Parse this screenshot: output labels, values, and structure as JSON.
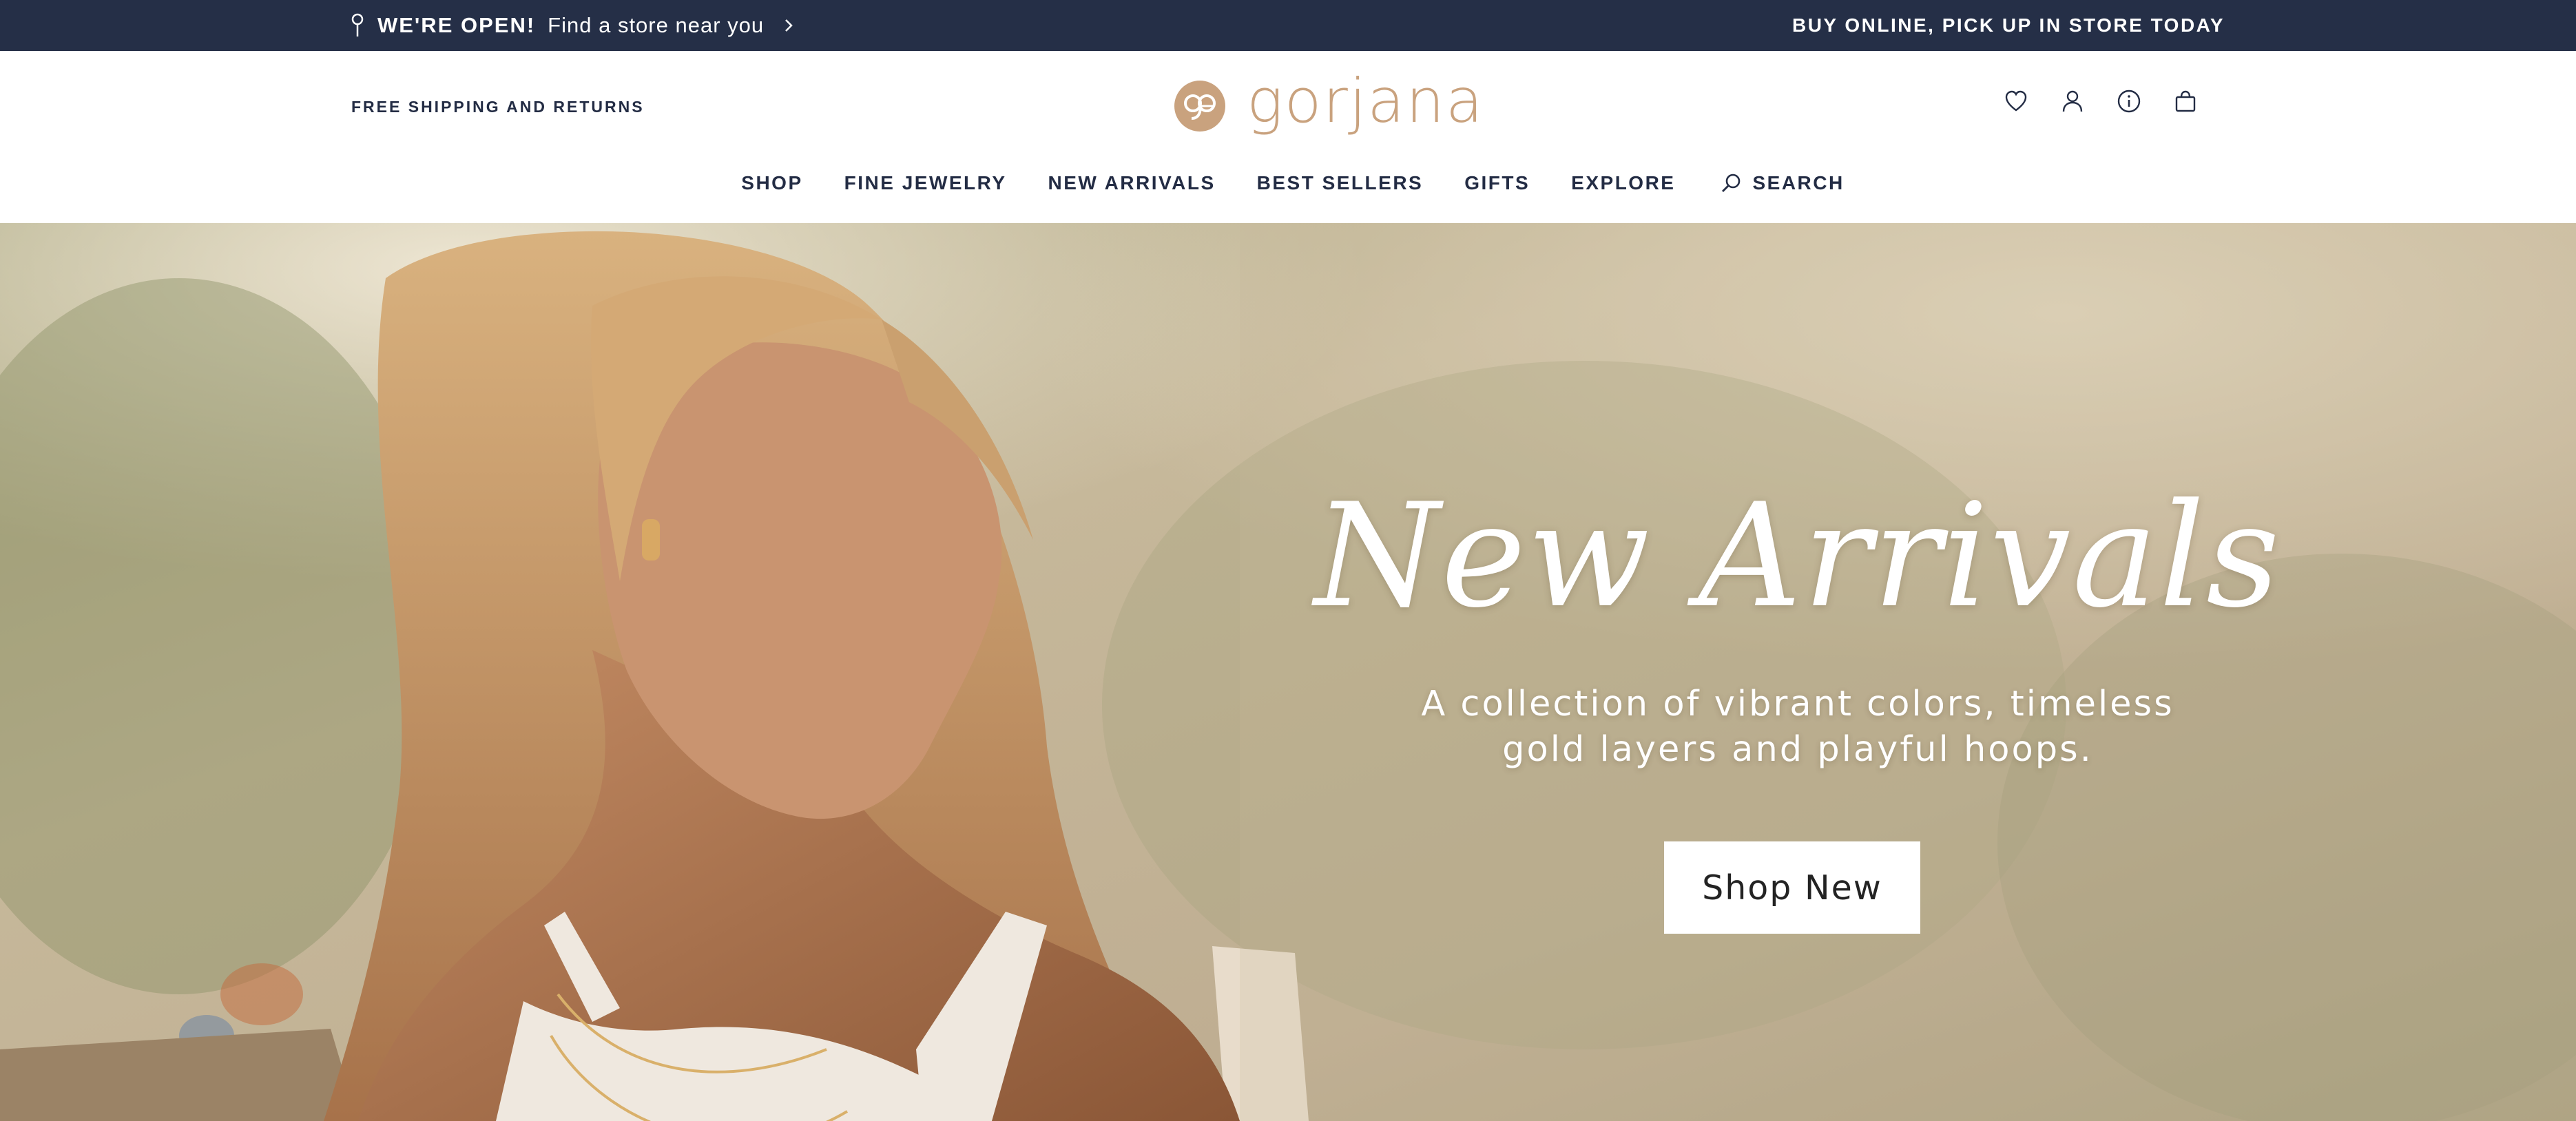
{
  "topbar": {
    "open_label": "WE'RE OPEN!",
    "store_link": "Find a store near you",
    "pickup": "BUY ONLINE, PICK UP IN STORE TODAY"
  },
  "header": {
    "shipping": "FREE SHIPPING AND RETURNS",
    "logo_text": "gorjana",
    "icons": [
      "heart-icon",
      "account-icon",
      "info-icon",
      "bag-icon"
    ]
  },
  "nav": {
    "items": [
      "SHOP",
      "FINE JEWELRY",
      "NEW ARRIVALS",
      "BEST SELLERS",
      "GIFTS",
      "EXPLORE"
    ],
    "search_label": "SEARCH"
  },
  "hero": {
    "title": "New Arrivals",
    "subtitle": "A collection of vibrant colors, timeless gold layers and playful hoops.",
    "cta": "Shop New"
  },
  "colors": {
    "topbar": "#252f47",
    "text": "#232c44",
    "brand": "#c9a27e",
    "hero_text": "#ffffff"
  }
}
